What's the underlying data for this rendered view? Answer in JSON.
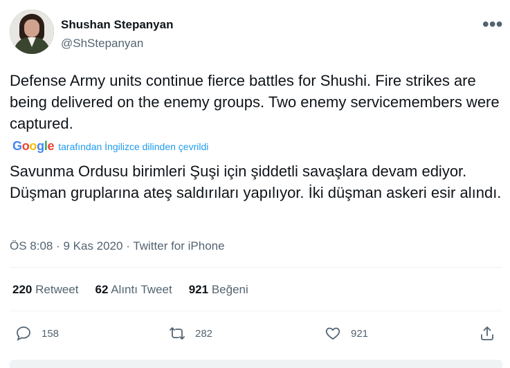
{
  "author": {
    "name": "Shushan Stepanyan",
    "handle": "@ShStepanyan"
  },
  "tweet": {
    "text": "Defense Army units continue fierce battles for Shushi. Fire strikes are being delivered on the enemy groups. Two enemy servicemembers were captured.",
    "translation_provider_text": "tarafından İngilizce dilinden çevrildi",
    "translated_text": "Savunma Ordusu birimleri Şuşi için şiddetli savaşlara devam ediyor. Düşman gruplarına ateş saldırıları yapılıyor. İki düşman askeri esir alındı.",
    "meta": "ÖS 8:08 · 9 Kas 2020 · Twitter for iPhone"
  },
  "stats": {
    "retweets_count": "220",
    "retweets_label": "Retweet",
    "quotes_count": "62",
    "quotes_label": "Alıntı Tweet",
    "likes_count": "921",
    "likes_label": "Beğeni"
  },
  "actions": {
    "reply_count": "158",
    "retweet_count": "282",
    "like_count": "921"
  },
  "icons": {
    "more": "more-horizontal-icon",
    "reply": "reply-icon",
    "retweet": "retweet-icon",
    "like": "heart-icon",
    "share": "share-icon",
    "google": "google-logo"
  },
  "colors": {
    "text": "#0f1419",
    "secondary": "#536471",
    "link": "#1d9bf0"
  }
}
